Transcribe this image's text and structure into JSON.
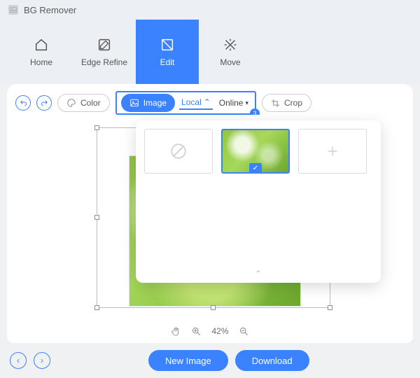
{
  "app": {
    "title": "BG Remover"
  },
  "nav": {
    "home": "Home",
    "edge": "Edge Refine",
    "edit": "Edit",
    "move": "Move"
  },
  "toolbar": {
    "color": "Color",
    "image": "Image",
    "local": "Local",
    "online": "Online",
    "crop": "Crop",
    "badge": "3"
  },
  "zoom": {
    "value": "42%"
  },
  "footer": {
    "new_image": "New Image",
    "download": "Download"
  }
}
